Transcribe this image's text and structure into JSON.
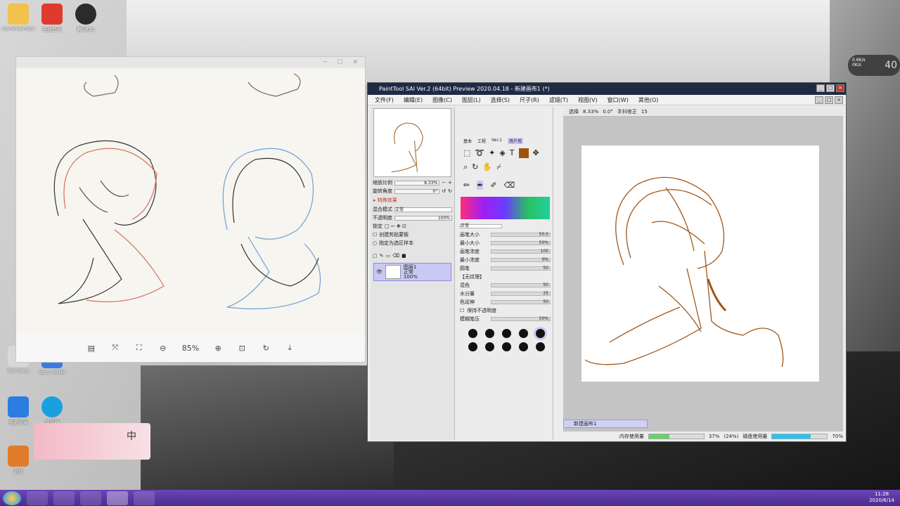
{
  "desktop": {
    "icons": [
      {
        "label": "Administrator",
        "icon": "user-folder-icon",
        "color": "#f2c14e"
      },
      {
        "label": "酷我音乐",
        "icon": "kuwo-music-icon",
        "color": "#e03a2f"
      },
      {
        "label": "腾讯QQ",
        "icon": "qq-penguin-icon",
        "color": "#2b2b2b"
      },
      {
        "label": "SAI Ver.2",
        "icon": "sai-icon",
        "color": "#d8d8d8"
      },
      {
        "label": "Ver.2 64bit",
        "icon": "sai-64-icon",
        "color": "#3b7be0"
      },
      {
        "label": "电脑管家",
        "icon": "shield-icon",
        "color": "#2a7de1"
      },
      {
        "label": "浏览器",
        "icon": "browser-icon",
        "color": "#1aa0e0"
      },
      {
        "label": "游戏",
        "icon": "game-icon",
        "color": "#e07c2a"
      }
    ]
  },
  "viewer": {
    "zoom": "85%",
    "toolbar_icons": [
      "thumbnail-icon",
      "fit-window-icon",
      "actual-size-icon",
      "zoom-out-icon",
      "zoom-in-icon",
      "one-to-one-icon",
      "rotate-icon",
      "download-icon"
    ]
  },
  "sai": {
    "title": "PaintTool SAI Ver.2 (64bit) Preview 2020.04.18 - 新建画布1 (*)",
    "menu": [
      "文件(F)",
      "编辑(E)",
      "图像(C)",
      "图层(L)",
      "选择(S)",
      "尺子(R)",
      "滤镜(T)",
      "视图(V)",
      "窗口(W)",
      "其他(O)"
    ],
    "navigator": {
      "zoom_label": "缩放比例",
      "zoom_value": "8.33%",
      "angle_label": "旋转角度",
      "angle_value": "0°"
    },
    "effects_heading": "特殊效果",
    "blend_label": "混合模式",
    "blend_value": "正常",
    "opacity_label": "不透明度",
    "opacity_value": "100%",
    "lock_label": "锁定",
    "clip_label": "创建剪贴蒙板",
    "sample_label": "指定为选区样本",
    "layer": {
      "name": "图层1",
      "mode": "正常",
      "opacity": "100%"
    },
    "tool_tabs": [
      "基本",
      "工程",
      "Ver.1",
      "用户用"
    ],
    "brush_mode": "正常",
    "params": [
      {
        "label": "画笔大小",
        "value": "50.0"
      },
      {
        "label": "最小大小",
        "value": "50%"
      },
      {
        "label": "画笔浓度",
        "value": "100"
      },
      {
        "label": "最小浓度",
        "value": "0%"
      }
    ],
    "shape": {
      "label": "圆笔",
      "value": "50"
    },
    "texture": "【无纹理】",
    "mix_params": [
      {
        "label": "混色",
        "value": "50"
      },
      {
        "label": "水分量",
        "value": "25"
      },
      {
        "label": "色延伸",
        "value": "50"
      }
    ],
    "keep_opacity": "保持不透明度",
    "blur_label": "模糊笔压",
    "blur_value": "50%",
    "brush_sizes": [
      "10",
      "12",
      "14",
      "16",
      "20",
      "25",
      "30",
      "35",
      "40",
      "50",
      "60",
      "70",
      "80",
      "100",
      "120"
    ],
    "canvas_toolbar": {
      "select": "选择",
      "zoom": "8.33%",
      "angle": "0.0°",
      "stabilizer_label": "手抖修正",
      "stabilizer_value": "15"
    },
    "canvas_tab": "新建画布1",
    "status": {
      "memory_label": "内存使用量",
      "memory_value": "37%",
      "memory_extra": "(24%)",
      "memory_fraction": 0.37,
      "disk_label": "磁盘使用量",
      "disk_value": "70%",
      "disk_fraction": 0.7
    }
  },
  "network": {
    "up": "0.6K/s",
    "down": "0K/s",
    "cpu": "40"
  },
  "taskbar": {
    "time": "11:28",
    "date": "2020/6/14",
    "apps": [
      "start-orb-icon",
      "skype-icon",
      "media-player-icon",
      "netease-music-icon",
      "sai-taskbar-icon",
      "qq-taskbar-icon"
    ]
  }
}
